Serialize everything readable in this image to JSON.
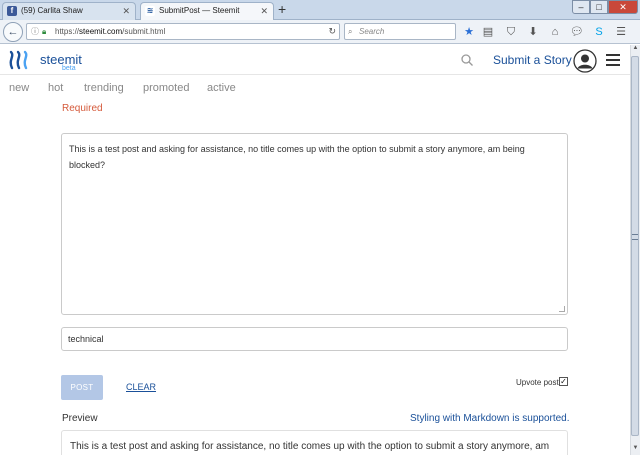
{
  "browser": {
    "tabs": [
      {
        "label": "(59) Carlita Shaw",
        "favicon": "facebook-icon",
        "active": false
      },
      {
        "label": "SubmitPost — Steemit",
        "favicon": "steemit-icon",
        "active": true
      }
    ],
    "url_prefix": "https://",
    "url_host": "steemit.com",
    "url_path": "/submit.html",
    "search_placeholder": "Search"
  },
  "header": {
    "brand": "steemit",
    "beta": "beta",
    "submit_story": "Submit a Story"
  },
  "subnav": {
    "items": [
      "new",
      "hot",
      "trending",
      "promoted",
      "active"
    ]
  },
  "form": {
    "required_label": "Required",
    "body_text": "This is a test post and asking for assistance, no title comes up with the option to submit a story anymore, am being blocked?",
    "tags_value": "technical",
    "post_label": "POST",
    "clear_label": "CLEAR",
    "upvote_label": "Upvote post",
    "upvote_checked": true
  },
  "preview": {
    "label": "Preview",
    "markdown_note": "Styling with Markdown is supported.",
    "text": "This is a test post and asking for assistance, no title comes up with the option to submit a story anymore, am"
  },
  "colors": {
    "brand_blue": "#1a5099",
    "required_red": "#d55a3b",
    "post_disabled": "#b3c7e6"
  }
}
